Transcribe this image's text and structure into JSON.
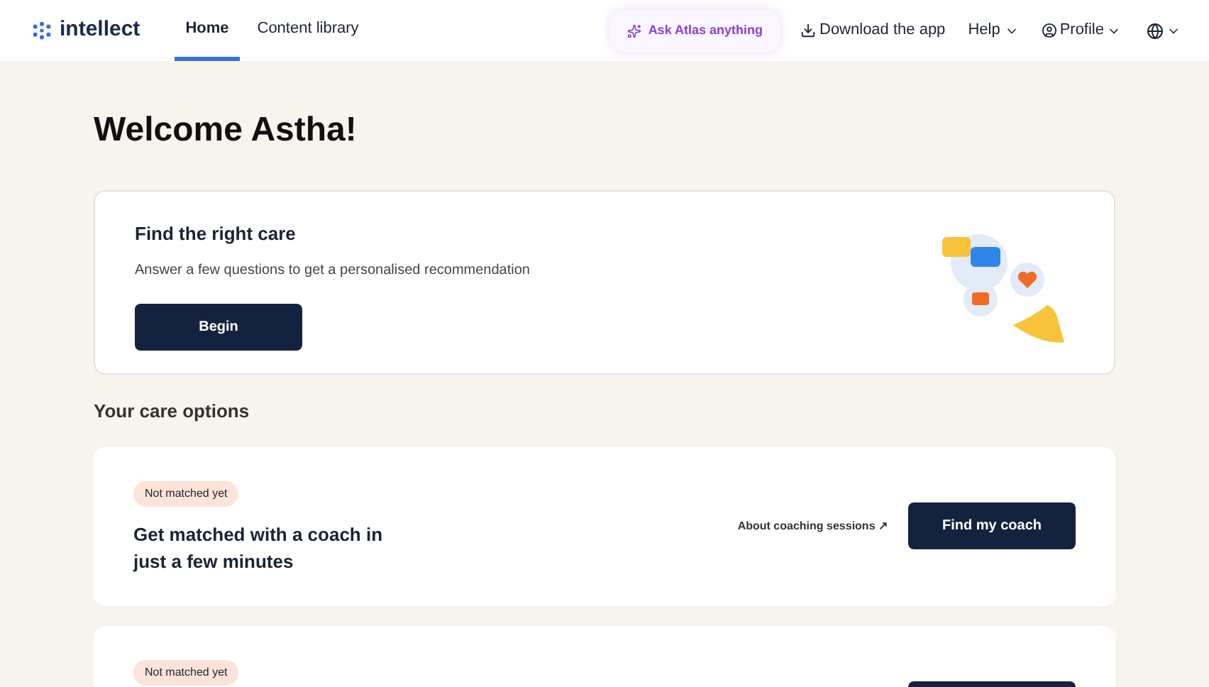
{
  "nav": {
    "logo": "intellect",
    "tabs": [
      {
        "label": "Home",
        "selected": true
      },
      {
        "label": "Content library",
        "selected": false
      }
    ],
    "ask": "Ask Atlas anything",
    "download": "Download the app",
    "help": "Help",
    "profile": "Profile"
  },
  "welcome": "Welcome Astha!",
  "care_card": {
    "title": "Find the right care",
    "subtitle": "Answer a few questions to get a personalised recommendation",
    "button": "Begin"
  },
  "options_heading": "Your care options",
  "options": [
    {
      "badge": "Not matched yet",
      "title": "Get matched with a coach in just a few minutes",
      "link": "About coaching sessions ↗",
      "button": "Find my coach"
    },
    {
      "badge": "Not matched yet"
    }
  ]
}
